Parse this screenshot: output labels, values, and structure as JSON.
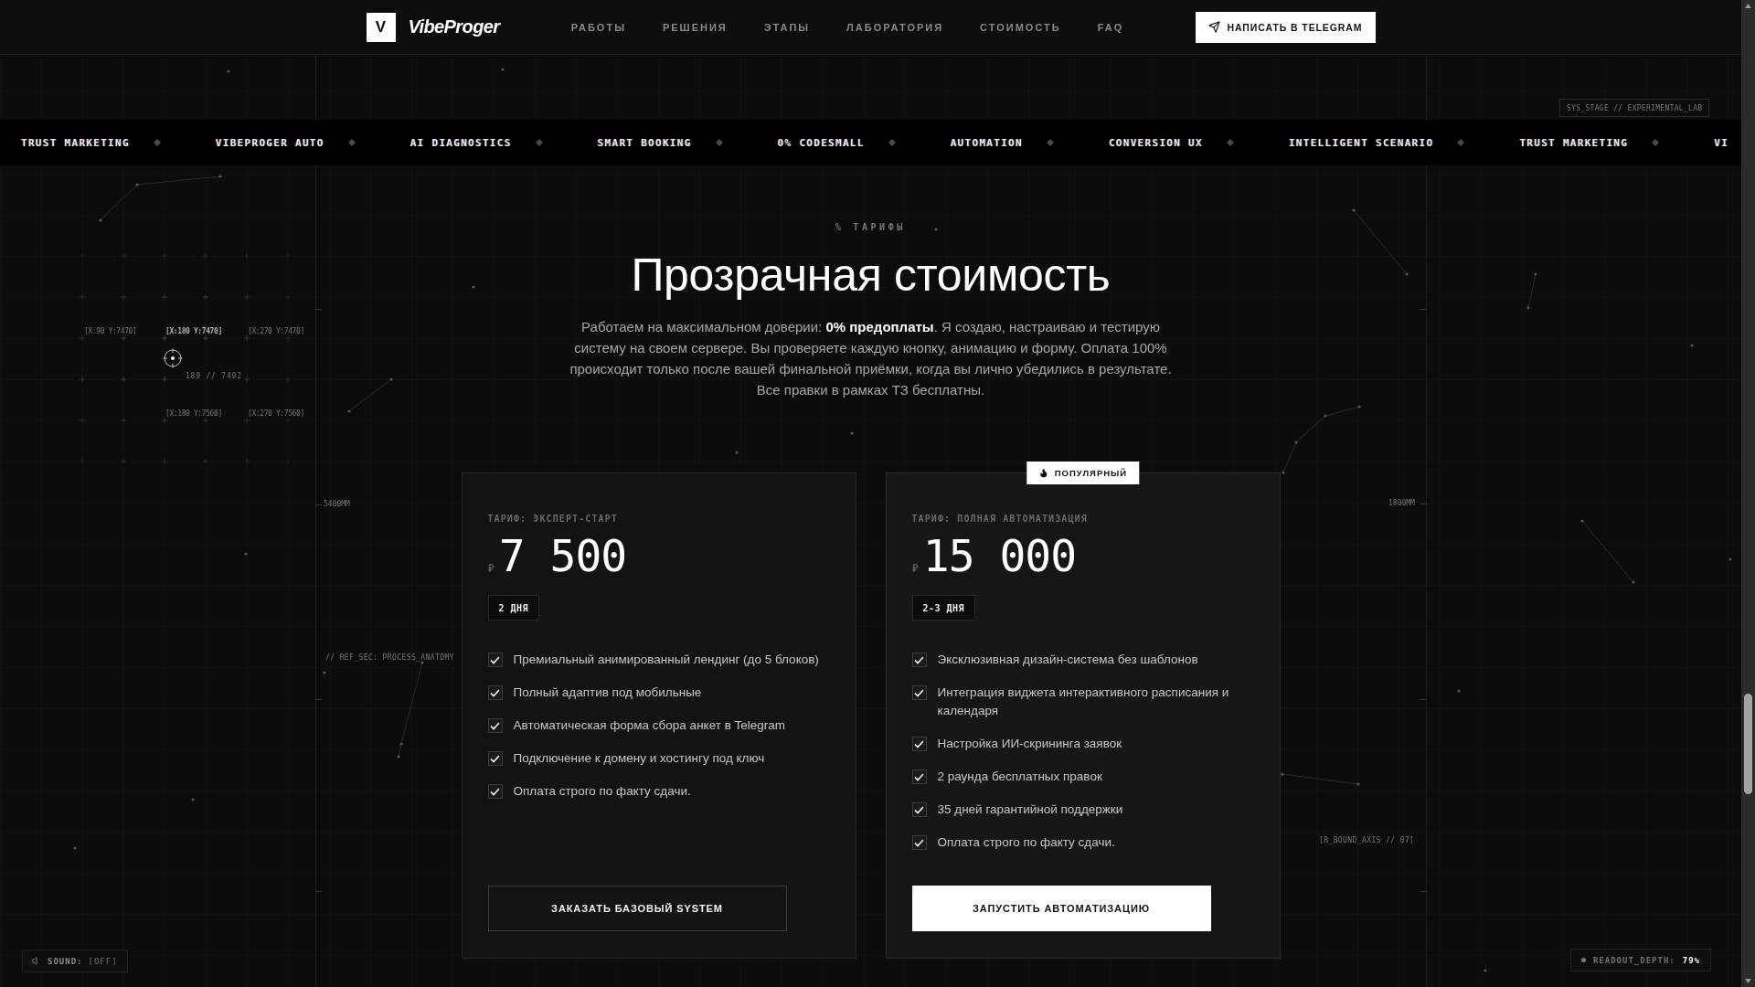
{
  "header": {
    "logo_mark": "V",
    "logo_text": "VibeProger",
    "nav": [
      "РАБОТЫ",
      "РЕШЕНИЯ",
      "ЭТАПЫ",
      "ЛАБОРАТОРИЯ",
      "СТОИМОСТЬ",
      "FAQ"
    ],
    "cta": "НАПИСАТЬ В TELEGRAM"
  },
  "ticker": [
    "TRUST MARKETING",
    "VIBEPROGER AUTO",
    "AI DIAGNOSTICS",
    "SMART BOOKING",
    "0% CODESMALL",
    "AUTOMATION",
    "CONVERSION UX",
    "INTELLIGENT SCENARIO",
    "TRUST MARKETING",
    "VI"
  ],
  "hud": {
    "stage_label": "SYS_STAGE // EXPERIMENTAL_LAB",
    "coordinates": [
      {
        "label": "[X:90 Y:7470]",
        "highlighted": false
      },
      {
        "label": "[X:180 Y:7470]",
        "highlighted": true
      },
      {
        "label": "[X:270 Y:7470]",
        "highlighted": false
      },
      {
        "label": "[X:180 Y:7560]",
        "highlighted": false
      },
      {
        "label": "[X:270 Y:7560]",
        "highlighted": false
      }
    ],
    "cursor_reading": "189 // 7492",
    "left_ruler_label": "5400MM",
    "right_ruler_label": "1800MM",
    "section_ref": "// REF_SEC: PROCESS_ANATOMY",
    "bound_axis": "[R_BOUND_AXIS // 07]"
  },
  "pricing": {
    "eyebrow": "% ТАРИФЫ",
    "title": "Прозрачная стоимость",
    "description": "Работаем на максимальном доверии: **0% предоплаты**. Я создаю, настраиваю и тестирую систему на своем сервере. Вы проверяете каждую кнопку, анимацию и форму. Оплата 100% происходит только после вашей финальной приёмки, когда вы лично убедились в результате. Все правки в рамках ТЗ бесплатны.",
    "plans": [
      {
        "featured": false,
        "tier": "ТАРИФ: ЭКСПЕРТ-СТАРТ",
        "currency": "₽",
        "price": "7 500",
        "duration": "2 ДНЯ",
        "features": [
          {
            "text": "Премиальный анимированный лендинг (до 5 блоков)",
            "checked": true
          },
          {
            "text": "Полный адаптив под мобильные",
            "checked": true
          },
          {
            "text": "Автоматическая форма сбора анкет в Telegram",
            "checked": true
          },
          {
            "text": "Подключение к домену и хостингу под ключ",
            "checked": true
          },
          {
            "text": "Оплата строго по факту сдачи.",
            "checked": true
          }
        ],
        "button": "ЗАКАЗАТЬ БАЗОВЫЙ SYSTEM"
      },
      {
        "featured": true,
        "badge": "ПОПУЛЯРНЫЙ",
        "tier": "ТАРИФ: ПОЛНАЯ АВТОМАТИЗАЦИЯ",
        "currency": "₽",
        "price": "15 000",
        "duration": "2-3 ДНЯ",
        "features": [
          {
            "text": "Эксклюзивная дизайн-система без шаблонов",
            "checked": true
          },
          {
            "text": "Интеграция виджета интерактивного расписания и календаря",
            "checked": true
          },
          {
            "text": "Настройка ИИ-скрининга заявок",
            "checked": true
          },
          {
            "text": "2 раунда бесплатных правок",
            "checked": true
          },
          {
            "text": "35 дней гарантийной поддержки",
            "checked": true
          },
          {
            "text": "Оплата строго по факту сдачи.",
            "checked": true
          }
        ],
        "button": "ЗАПУСТИТЬ АВТОМАТИЗАЦИЮ"
      }
    ]
  },
  "sound": {
    "label": "SOUND:",
    "value": "[OFF]"
  },
  "readout": {
    "label": "READOUT_DEPTH:",
    "value": "79%"
  }
}
